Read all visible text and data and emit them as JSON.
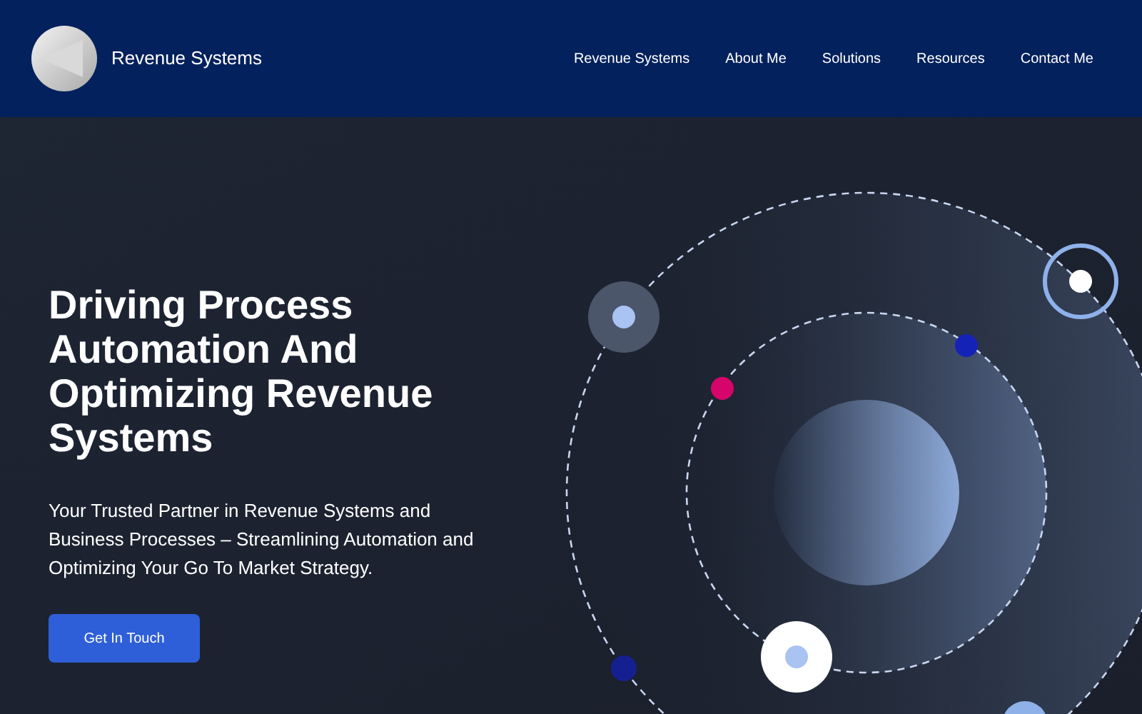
{
  "header": {
    "brand": "Revenue Systems",
    "nav": [
      "Revenue Systems",
      "About Me",
      "Solutions",
      "Resources",
      "Contact Me"
    ]
  },
  "hero": {
    "title": "Driving Process Automation And Optimizing Revenue Systems",
    "subtitle": "Your Trusted Partner in Revenue Systems and Business Processes – Streamlining Automation and Optimizing Your Go To Market Strategy.",
    "button": "Get In Touch"
  }
}
